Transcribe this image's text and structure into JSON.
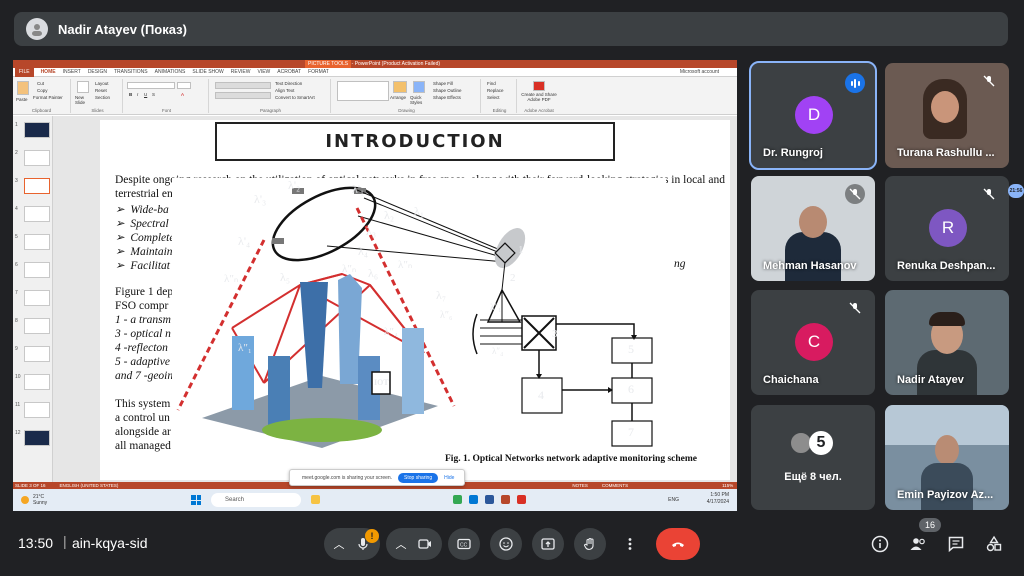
{
  "topbar": {
    "presenter": "Nadir Atayev (Показ)"
  },
  "ppt": {
    "window_title": "Final Presentation - PowerPoint (Product Activation Failed)",
    "picture_tools": "PICTURE TOOLS",
    "tabs": [
      "FILE",
      "HOME",
      "INSERT",
      "DESIGN",
      "TRANSITIONS",
      "ANIMATIONS",
      "SLIDE SHOW",
      "REVIEW",
      "VIEW",
      "ACROBAT",
      "FORMAT"
    ],
    "account": "Microsoft account",
    "ribbon": {
      "cut": "Cut",
      "copy": "Copy",
      "format_painter": "Format Painter",
      "paste": "Paste",
      "clipboard": "Clipboard",
      "new_slide": "New Slide",
      "layout": "Layout",
      "reset": "Reset",
      "section": "Section",
      "slides": "Slides",
      "font_group": "Font",
      "paragraph": "Paragraph",
      "text_direction": "Text Direction",
      "align_text": "Align Text",
      "smartart": "Convert to SmartArt",
      "drawing": "Drawing",
      "arrange": "Arrange",
      "quick_styles": "Quick Styles",
      "shape_fill": "Shape Fill",
      "shape_outline": "Shape Outline",
      "shape_effects": "Shape Effects",
      "find": "Find",
      "replace": "Replace",
      "select": "Select",
      "editing": "Editing",
      "create_share": "Create and Share Adobe PDF",
      "adobe_acrobat": "Adobe Acrobat"
    },
    "thumb_numbers": [
      "1",
      "2",
      "3",
      "4",
      "5",
      "6",
      "7",
      "8",
      "9",
      "10",
      "11",
      "12"
    ],
    "status": {
      "slide": "SLIDE 3 OF 16",
      "lang": "ENGLISH (UNITED STATES)",
      "notes": "NOTES",
      "comments": "COMMENTS",
      "zoom": "115%"
    }
  },
  "slide": {
    "title": "INTRODUCTION",
    "lines": [
      "Despite ongoing research on the utilization of optical networks in free space, along with their forward-looking strategies in local and",
      "terrestrial en",
      "Wide-ba",
      "Spectral",
      "Complete",
      "Maintain",
      "Facilitat",
      "Figure 1 dep",
      "FSO compr",
      "1 - a transm",
      "3 - optical n",
      "4 -reflecton",
      "5 - adaptive",
      "and 7 -geoin",
      "This system",
      "a control un",
      "alongside ar",
      "all managed"
    ],
    "bullet_tail": "ng",
    "caption": "Fig. 1. Optical Networks network adaptive monitoring scheme"
  },
  "figure": {
    "sat_labels": [
      "λ'₁",
      "λ'₂",
      "λ'₃",
      "λ'₄"
    ],
    "beam_labels": [
      "λ₁",
      "λ₂",
      "λ₃",
      "λ₄"
    ],
    "city_labels": [
      "λ₅",
      "λ₆",
      "λ₇",
      "λ″ₙ",
      "λ″₁",
      "λ″₄",
      "λ″ₙ",
      "λ″ₙ",
      "λ″₆"
    ],
    "node_labels": [
      "1",
      "2",
      "3"
    ],
    "mux_labels": [
      "λ″₁",
      "λ″₄"
    ],
    "block_labels": [
      "5",
      "6",
      "4",
      "7"
    ],
    "iot": "IOT"
  },
  "taskbar": {
    "temp": "21°C",
    "weather": "Sunny",
    "search": "Search",
    "lang": "ENG",
    "time": "1:50 PM",
    "date": "4/17/2024"
  },
  "sharing": {
    "message": "meet.google.com is sharing your screen.",
    "stop": "Stop sharing",
    "hide": "Hide"
  },
  "participants": [
    {
      "name": "Dr. Rungroj",
      "initial": "D",
      "color": "#a142f4"
    },
    {
      "name": "Turana Rashullu ..."
    },
    {
      "name": "Mehman Hasanov"
    },
    {
      "name": "Renuka Deshpan...",
      "initial": "R",
      "color": "#7e57c2"
    },
    {
      "name": "Chaichana",
      "initial": "C",
      "color": "#d81b60"
    },
    {
      "name": "Nadir Atayev"
    },
    {
      "more_label": "Ещё 8 чел.",
      "more_count": "5"
    },
    {
      "name": "Emin Payizov Az..."
    }
  ],
  "side_badge": "21:56",
  "bottom": {
    "time": "13:50",
    "sep": "|",
    "code": "ain-kqya-sid",
    "warn": "!",
    "people_count": "16"
  }
}
